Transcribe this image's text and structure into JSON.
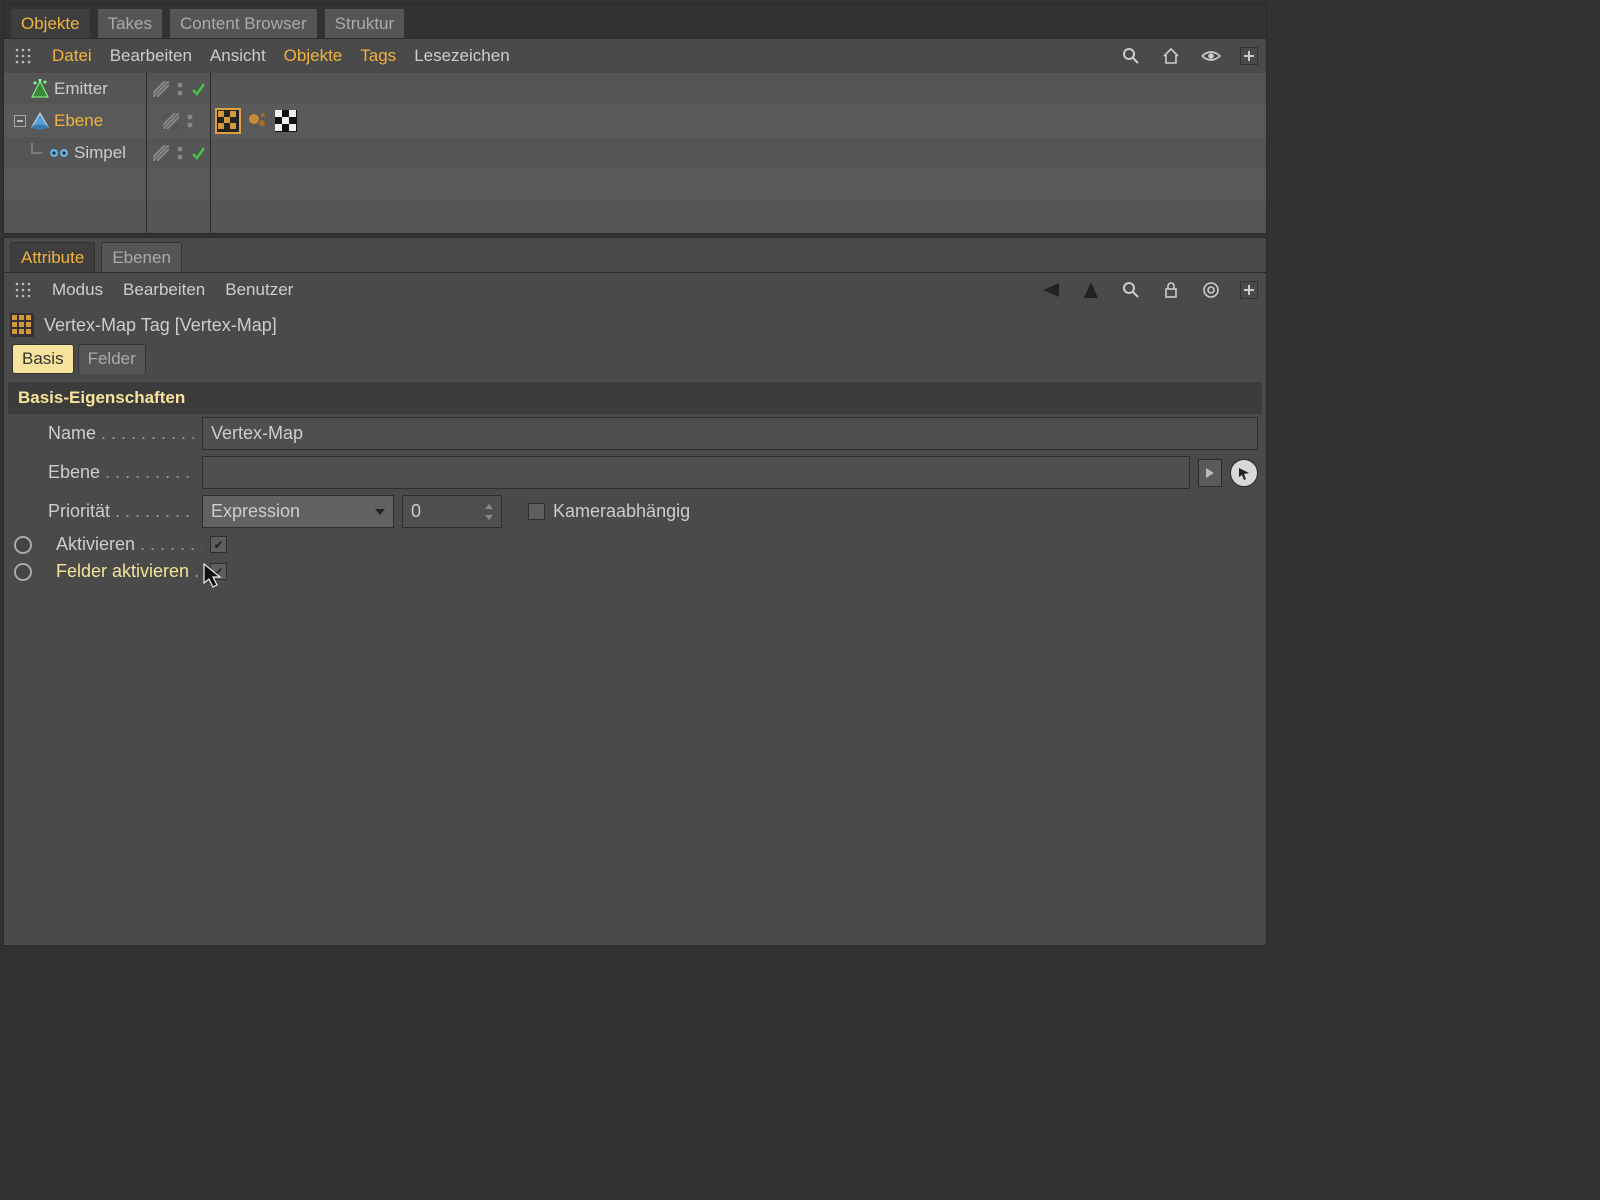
{
  "topTabs": [
    {
      "label": "Objekte",
      "active": true
    },
    {
      "label": "Takes",
      "active": false
    },
    {
      "label": "Content Browser",
      "active": false
    },
    {
      "label": "Struktur",
      "active": false
    }
  ],
  "objToolbar": {
    "items": [
      {
        "label": "Datei",
        "accent": true
      },
      {
        "label": "Bearbeiten",
        "accent": false
      },
      {
        "label": "Ansicht",
        "accent": false
      },
      {
        "label": "Objekte",
        "accent": true
      },
      {
        "label": "Tags",
        "accent": true
      },
      {
        "label": "Lesezeichen",
        "accent": false
      }
    ]
  },
  "objects": [
    {
      "name": "Emitter",
      "depth": 0,
      "selected": false,
      "vis": "green",
      "tags": [],
      "expand": null,
      "icon": "emitter"
    },
    {
      "name": "Ebene",
      "depth": 0,
      "selected": true,
      "vis": "dots",
      "tags": [
        "checker",
        "particles",
        "alpha"
      ],
      "expand": "minus",
      "icon": "cone"
    },
    {
      "name": "Simpel",
      "depth": 1,
      "selected": false,
      "vis": "green",
      "tags": [],
      "expand": "leaf",
      "icon": "eyes"
    }
  ],
  "attrTabs": [
    {
      "label": "Attribute",
      "active": true
    },
    {
      "label": "Ebenen",
      "active": false
    }
  ],
  "attrToolbar": [
    "Modus",
    "Bearbeiten",
    "Benutzer"
  ],
  "attrTitle": "Vertex-Map Tag [Vertex-Map]",
  "attrSubTabs": [
    {
      "label": "Basis",
      "active": true
    },
    {
      "label": "Felder",
      "active": false
    }
  ],
  "sectionHeader": "Basis-Eigenschaften",
  "fields": {
    "name": {
      "label": "Name",
      "value": "Vertex-Map"
    },
    "ebene": {
      "label": "Ebene",
      "value": ""
    },
    "prio": {
      "label": "Priorität",
      "dropdown": "Expression",
      "num": "0",
      "chkLabel": "Kameraabhängig",
      "chk": false
    },
    "aktivieren": {
      "label": "Aktivieren",
      "chk": true
    },
    "felder": {
      "label": "Felder aktivieren",
      "chk": true
    }
  }
}
